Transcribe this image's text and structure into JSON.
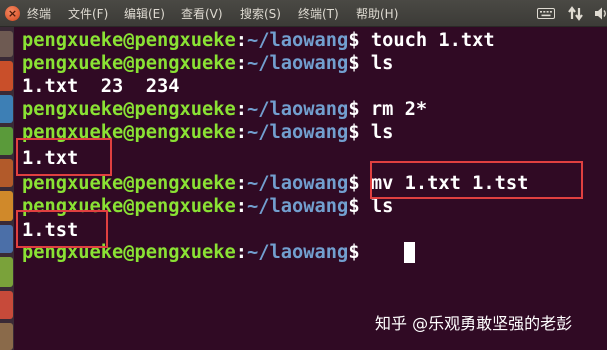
{
  "menu": {
    "items": [
      "终端",
      "文件(F)",
      "编辑(E)",
      "查看(V)",
      "搜索(S)",
      "终端(T)",
      "帮助(H)"
    ],
    "close_glyph": "×"
  },
  "tray_icons": [
    "keyboard-icon",
    "network-icon",
    "volume-icon"
  ],
  "terminal": {
    "user_host": "pengxueke@pengxueke",
    "colon": ":",
    "path": "~/laowang",
    "dollar": "$",
    "lines": [
      {
        "type": "prompt",
        "cmd": " touch 1.txt"
      },
      {
        "type": "prompt",
        "cmd": " ls"
      },
      {
        "type": "output",
        "text": "1.txt  23  234"
      },
      {
        "type": "prompt",
        "cmd": " rm 2*"
      },
      {
        "type": "prompt",
        "cmd": " ls"
      },
      {
        "type": "output",
        "text": "1.txt"
      },
      {
        "type": "prompt",
        "cmd": " mv 1.txt 1.tst"
      },
      {
        "type": "prompt",
        "cmd": " ls"
      },
      {
        "type": "output",
        "text": "1.tst"
      },
      {
        "type": "prompt",
        "cmd": " "
      }
    ]
  },
  "watermark": "知乎 @乐观勇敢坚强的老彭",
  "colors": {
    "background": "#300a24",
    "user_host": "#8ae234",
    "path": "#729fcf",
    "text": "#ffffff",
    "highlight_box": "#e04040",
    "menubar": "#3c3b37"
  }
}
